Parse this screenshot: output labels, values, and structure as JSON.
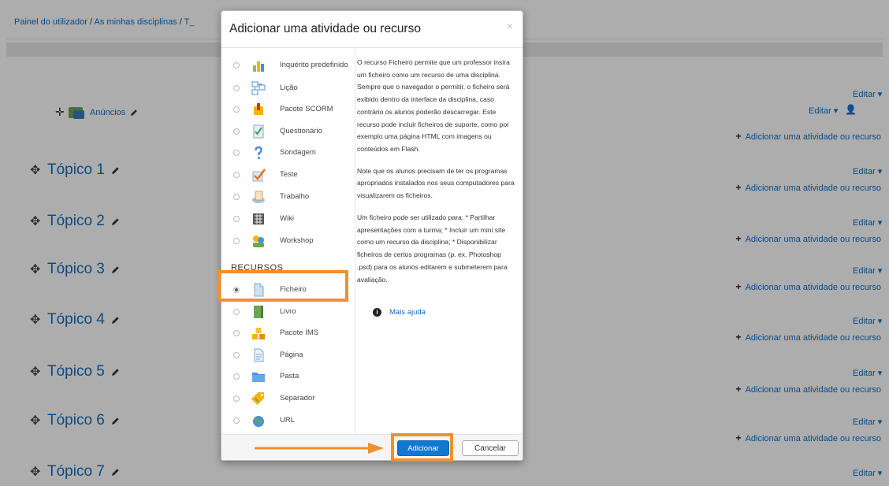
{
  "breadcrumb": {
    "dashboard": "Painel do utilizador",
    "sep1": "/",
    "courses": "As minhas disciplinas",
    "sep2": "/",
    "course": "T_"
  },
  "announcements": {
    "label": "Anúncios"
  },
  "edit_label": "Editar ▾",
  "add_activity_label": "Adicionar uma atividade ou recurso",
  "topics": [
    "Tópico 1",
    "Tópico 2",
    "Tópico 3",
    "Tópico 4",
    "Tópico 5",
    "Tópico 6",
    "Tópico 7"
  ],
  "modal": {
    "title": "Adicionar uma atividade ou recurso",
    "close": "×",
    "activities": [
      {
        "label": "Inquérito predefinido",
        "icon": "survey-icon"
      },
      {
        "label": "Lição",
        "icon": "lesson-icon"
      },
      {
        "label": "Pacote SCORM",
        "icon": "scorm-icon"
      },
      {
        "label": "Questionário",
        "icon": "quiz-icon"
      },
      {
        "label": "Sondagem",
        "icon": "choice-icon"
      },
      {
        "label": "Teste",
        "icon": "test-icon"
      },
      {
        "label": "Trabalho",
        "icon": "assignment-icon"
      },
      {
        "label": "Wiki",
        "icon": "wiki-icon"
      },
      {
        "label": "Workshop",
        "icon": "workshop-icon"
      }
    ],
    "resources_heading": "RECURSOS",
    "resources": [
      {
        "label": "Ficheiro",
        "icon": "file-icon",
        "selected": true
      },
      {
        "label": "Livro",
        "icon": "book-icon"
      },
      {
        "label": "Pacote IMS",
        "icon": "ims-package-icon"
      },
      {
        "label": "Página",
        "icon": "page-icon"
      },
      {
        "label": "Pasta",
        "icon": "folder-icon"
      },
      {
        "label": "Separador",
        "icon": "label-icon"
      },
      {
        "label": "URL",
        "icon": "url-icon"
      }
    ],
    "help": [
      "O recurso Ficheiro permite que um professor insira um ficheiro como um recurso de uma disciplina. Sempre que o navegador o permitir, o ficheiro será exibido dentro da interface da disciplina, caso contrário os alunos poderão descarregar. Este recurso pode incluir ficheiros de suporte, como por exemplo uma página HTML com imagens ou conteúdos em Flash.",
      "Note que os alunos precisam de ter os programas apropriados instalados nos seus computadores para visualizarem os ficheiros.",
      "Um ficheiro pode ser utilizado para: * Partilhar apresentações com a turma; * Incluir um mini site como um recurso da disciplina; * Disponibilizar ficheiros de certos programas (p. ex. Photoshop .psd) para os alunos editarem e submeterem para avaliação."
    ],
    "more_help": "Mais ajuda",
    "add_button": "Adicionar",
    "cancel_button": "Cancelar"
  },
  "colors": {
    "link": "#0f6fc5",
    "accent_annotation": "#f0902e",
    "primary_button": "#1177d1"
  }
}
